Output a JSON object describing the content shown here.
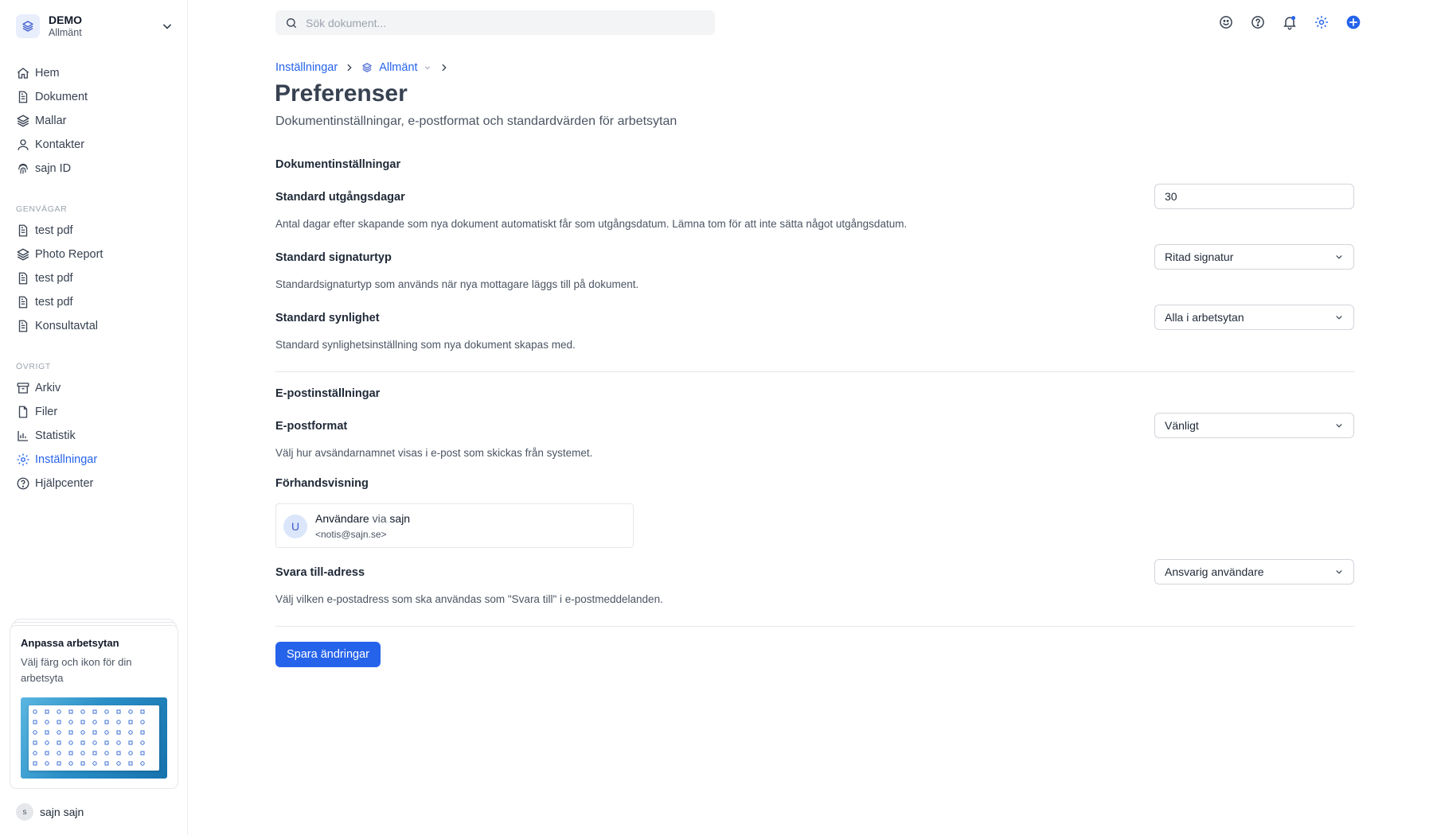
{
  "workspace": {
    "name": "DEMO",
    "subtitle": "Allmänt"
  },
  "nav_main": [
    {
      "label": "Hem",
      "icon": "home-icon"
    },
    {
      "label": "Dokument",
      "icon": "document-icon"
    },
    {
      "label": "Mallar",
      "icon": "layers-icon"
    },
    {
      "label": "Kontakter",
      "icon": "user-icon"
    },
    {
      "label": "sajn ID",
      "icon": "fingerprint-icon"
    }
  ],
  "shortcuts": {
    "heading": "GENVÄGAR",
    "items": [
      {
        "label": "test pdf",
        "icon": "document-icon"
      },
      {
        "label": "Photo Report",
        "icon": "layers-icon"
      },
      {
        "label": "test pdf",
        "icon": "document-icon"
      },
      {
        "label": "test pdf",
        "icon": "document-icon"
      },
      {
        "label": "Konsultavtal",
        "icon": "document-icon"
      }
    ]
  },
  "other": {
    "heading": "ÖVRIGT",
    "items": [
      {
        "label": "Arkiv",
        "icon": "archive-icon"
      },
      {
        "label": "Filer",
        "icon": "file-icon"
      },
      {
        "label": "Statistik",
        "icon": "bar-chart-icon"
      },
      {
        "label": "Inställningar",
        "icon": "gear-icon",
        "active": true
      },
      {
        "label": "Hjälpcenter",
        "icon": "help-circle-icon"
      }
    ]
  },
  "promo": {
    "title": "Anpassa arbetsytan",
    "description": "Välj färg och ikon för din arbetsyta"
  },
  "user": {
    "initial": "s",
    "name": "sajn sajn"
  },
  "search": {
    "placeholder": "Sök dokument..."
  },
  "breadcrumb": {
    "root": "Inställningar",
    "current": "Allmänt"
  },
  "page": {
    "title": "Preferenser",
    "subtitle": "Dokumentinställningar, e-postformat och standardvärden för arbetsytan"
  },
  "document_settings": {
    "heading": "Dokumentinställningar",
    "expiry": {
      "label": "Standard utgångsdagar",
      "value": "30",
      "help": "Antal dagar efter skapande som nya dokument automatiskt får som utgångsdatum. Lämna tom för att inte sätta något utgångsdatum."
    },
    "signature": {
      "label": "Standard signaturtyp",
      "value": "Ritad signatur",
      "help": "Standardsignaturtyp som används när nya mottagare läggs till på dokument."
    },
    "visibility": {
      "label": "Standard synlighet",
      "value": "Alla i arbetsytan",
      "help": "Standard synlighetsinställning som nya dokument skapas med."
    }
  },
  "email_settings": {
    "heading": "E-postinställningar",
    "format": {
      "label": "E-postformat",
      "value": "Vänligt",
      "help": "Välj hur avsändarnamnet visas i e-post som skickas från systemet."
    },
    "preview": {
      "label": "Förhandsvisning",
      "avatar": "U",
      "sender": "Användare",
      "via": "via",
      "app": "sajn",
      "address": "<notis@sajn.se>"
    },
    "reply_to": {
      "label": "Svara till-adress",
      "value": "Ansvarig användare",
      "help": "Välj vilken e-postadress som ska användas som \"Svara till\" i e-postmeddelanden."
    }
  },
  "actions": {
    "save": "Spara ändringar"
  },
  "colors": {
    "accent": "#2563eb",
    "text": "#1f2937",
    "muted": "#4b5563",
    "border": "#d1d5db"
  }
}
